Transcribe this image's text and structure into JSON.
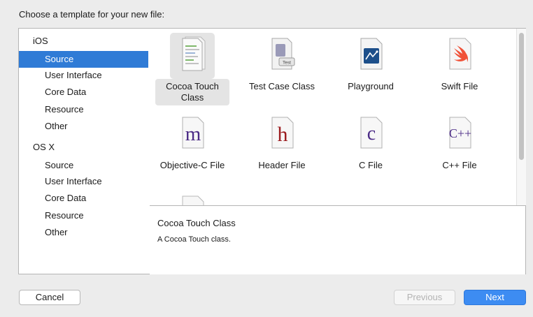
{
  "dialog": {
    "heading": "Choose a template for your new file:"
  },
  "sidebar": {
    "items": [
      {
        "label": "iOS",
        "kind": "group",
        "selected": false
      },
      {
        "label": "Source",
        "kind": "child",
        "selected": true
      },
      {
        "label": "User Interface",
        "kind": "child",
        "selected": false
      },
      {
        "label": "Core Data",
        "kind": "child",
        "selected": false
      },
      {
        "label": "Resource",
        "kind": "child",
        "selected": false
      },
      {
        "label": "Other",
        "kind": "child",
        "selected": false
      },
      {
        "label": "OS X",
        "kind": "group",
        "selected": false
      },
      {
        "label": "Source",
        "kind": "child",
        "selected": false
      },
      {
        "label": "User Interface",
        "kind": "child",
        "selected": false
      },
      {
        "label": "Core Data",
        "kind": "child",
        "selected": false
      },
      {
        "label": "Resource",
        "kind": "child",
        "selected": false
      },
      {
        "label": "Other",
        "kind": "child",
        "selected": false
      }
    ]
  },
  "templates": [
    {
      "label": "Cocoa Touch Class",
      "icon": "cocoa-touch-class-icon",
      "selected": true
    },
    {
      "label": "Test Case Class",
      "icon": "test-case-class-icon",
      "badge": "Test",
      "selected": false
    },
    {
      "label": "Playground",
      "icon": "playground-icon",
      "selected": false
    },
    {
      "label": "Swift File",
      "icon": "swift-file-icon",
      "selected": false
    },
    {
      "label": "Objective-C File",
      "icon": "objective-c-file-icon",
      "letter": "m",
      "selected": false
    },
    {
      "label": "Header File",
      "icon": "header-file-icon",
      "letter": "h",
      "selected": false
    },
    {
      "label": "C File",
      "icon": "c-file-icon",
      "letter": "c",
      "selected": false
    },
    {
      "label": "C++ File",
      "icon": "cpp-file-icon",
      "letter": "C++",
      "selected": false
    }
  ],
  "detail": {
    "title": "Cocoa Touch Class",
    "description": "A Cocoa Touch class."
  },
  "buttons": {
    "cancel": "Cancel",
    "previous": "Previous",
    "next": "Next"
  },
  "colors": {
    "selection": "#2f7bd6",
    "primary_button": "#3d8cf2",
    "swift": "#f05138",
    "letter_purple": "#4b2b86",
    "letter_red": "#9c1d20"
  }
}
